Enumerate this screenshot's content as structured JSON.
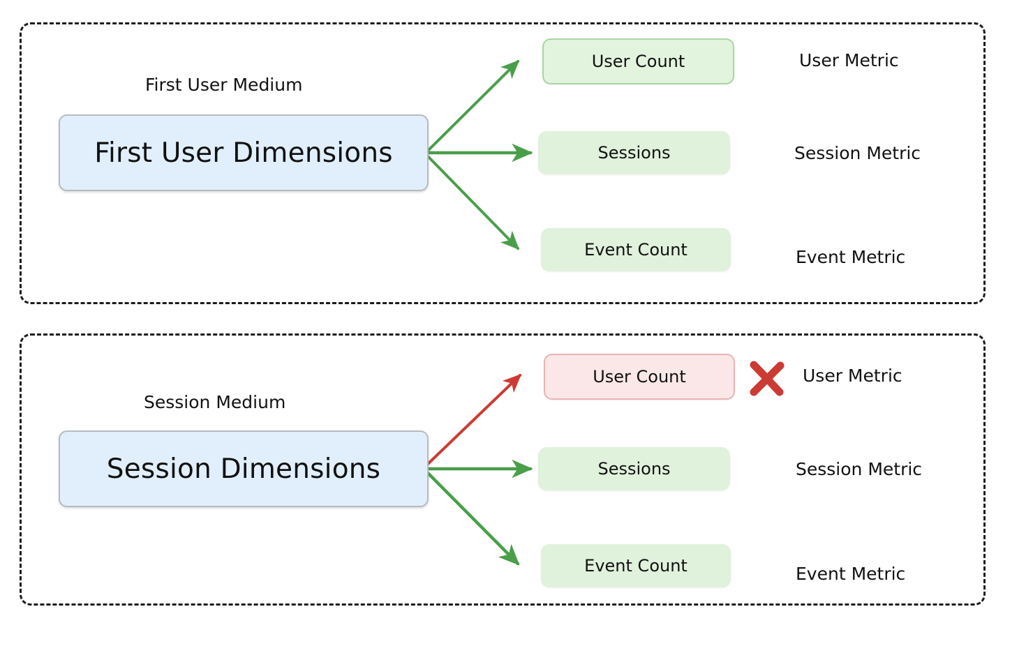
{
  "diagram": {
    "title_absent": true,
    "colors": {
      "dimension_fill": "#e1effd",
      "dimension_border": "#b6babd",
      "metric_green_fill": "#e0f1dc",
      "metric_green_border": "#a9d5a3",
      "metric_red_fill": "#fbe7e7",
      "metric_red_border": "#e9b3b7",
      "arrow_valid": "#4a9e4a",
      "arrow_invalid": "#cc3b33",
      "x_mark": "#cc3b33",
      "panel_border": "#1c1c1c",
      "text": "#111111",
      "background": "#ffffff"
    },
    "groups": [
      {
        "id": "first-user",
        "caption": "First User Medium",
        "dimension_label": "First User Dimensions",
        "metrics": [
          {
            "box_label": "User Count",
            "side_label": "User Metric",
            "state": "valid",
            "box_style": "green-outline",
            "arrow": "valid",
            "mark": null
          },
          {
            "box_label": "Sessions",
            "side_label": "Session Metric",
            "state": "valid",
            "box_style": "green-plain",
            "arrow": "valid",
            "mark": null
          },
          {
            "box_label": "Event Count",
            "side_label": "Event Metric",
            "state": "valid",
            "box_style": "green-plain",
            "arrow": "valid",
            "mark": null
          }
        ]
      },
      {
        "id": "session",
        "caption": "Session Medium",
        "dimension_label": "Session Dimensions",
        "metrics": [
          {
            "box_label": "User Count",
            "side_label": "User Metric",
            "state": "invalid",
            "box_style": "red-outline",
            "arrow": "invalid",
            "mark": "x-mark"
          },
          {
            "box_label": "Sessions",
            "side_label": "Session Metric",
            "state": "valid",
            "box_style": "green-plain",
            "arrow": "valid",
            "mark": null
          },
          {
            "box_label": "Event Count",
            "side_label": "Event Metric",
            "state": "valid",
            "box_style": "green-plain",
            "arrow": "valid",
            "mark": null
          }
        ]
      }
    ]
  }
}
